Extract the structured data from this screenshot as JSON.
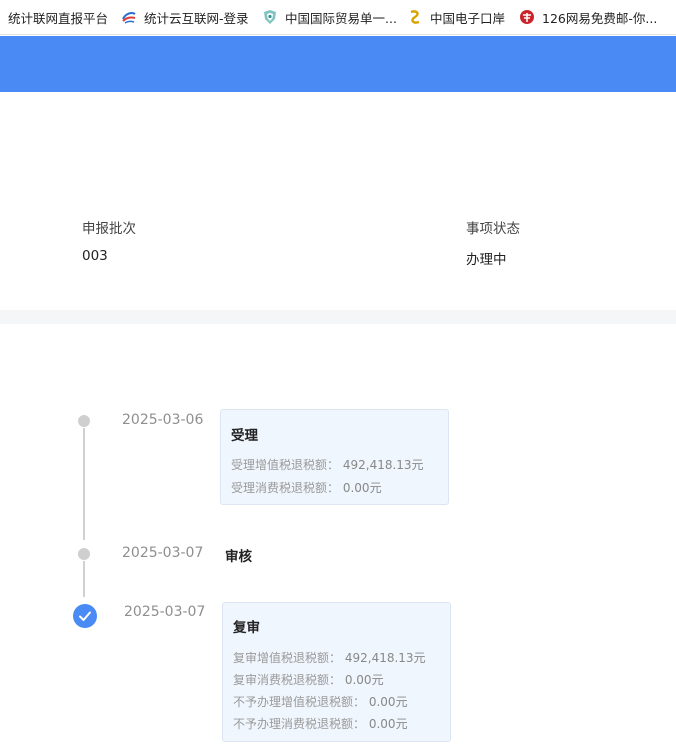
{
  "bookmarks": [
    {
      "label": "统计联网直报平台",
      "icon": "none"
    },
    {
      "label": "统计云互联网-登录",
      "icon": "swirl-logo-icon"
    },
    {
      "label": "中国国际贸易单一...",
      "icon": "shield-logo-icon"
    },
    {
      "label": "中国电子口岸",
      "icon": "gold-logo-icon"
    },
    {
      "label": "126网易免费邮-你...",
      "icon": "netease-logo-icon"
    }
  ],
  "colors": {
    "header_blue": "#4a8af4",
    "card_bg": "#f0f6fd",
    "muted_text": "#9a9a9a"
  },
  "info": {
    "batch_label": "申报批次",
    "batch_value": "003",
    "status_label": "事项状态",
    "status_value": "办理中"
  },
  "timeline": [
    {
      "date": "2025-03-06",
      "title": "受理",
      "lines": [
        {
          "label": "受理增值税退税额：",
          "value": "492,418.13元"
        },
        {
          "label": "受理消费税退税额：",
          "value": "0.00元"
        }
      ]
    },
    {
      "date": "2025-03-07",
      "title": "审核",
      "lines": []
    },
    {
      "date": "2025-03-07",
      "title": "复审",
      "completed": true,
      "lines": [
        {
          "label": "复审增值税退税额：",
          "value": "492,418.13元"
        },
        {
          "label": "复审消费税退税额：",
          "value": "0.00元"
        },
        {
          "label": "不予办理增值税退税额：",
          "value": "0.00元"
        },
        {
          "label": "不予办理消费税退税额：",
          "value": "0.00元"
        }
      ]
    }
  ]
}
